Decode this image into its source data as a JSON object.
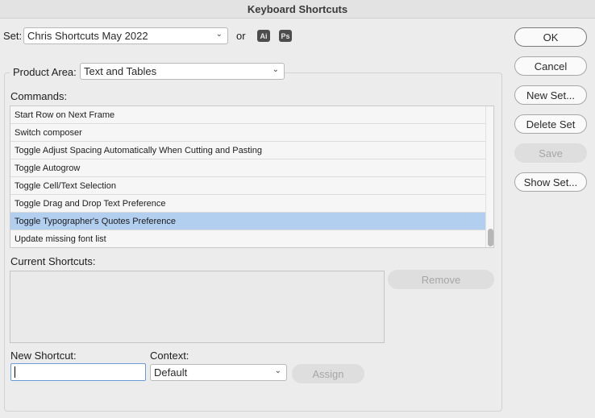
{
  "window": {
    "title": "Keyboard Shortcuts"
  },
  "set": {
    "label": "Set:",
    "value": "Chris Shortcuts May 2022",
    "or_label": "or",
    "app_icons": [
      "Ai",
      "Ps"
    ]
  },
  "product_area": {
    "label": "Product Area:",
    "value": "Text and Tables"
  },
  "commands": {
    "label": "Commands:",
    "items": [
      "Start Row on Next Frame",
      "Switch composer",
      "Toggle Adjust Spacing Automatically When Cutting and Pasting",
      "Toggle Autogrow",
      "Toggle Cell/Text Selection",
      "Toggle Drag and Drop Text Preference",
      "Toggle Typographer's Quotes Preference",
      "Update missing font list"
    ],
    "selected_index": 6
  },
  "current_shortcuts": {
    "label": "Current Shortcuts:",
    "remove_label": "Remove"
  },
  "new_shortcut": {
    "label": "New Shortcut:",
    "value": ""
  },
  "context": {
    "label": "Context:",
    "value": "Default",
    "assign_label": "Assign"
  },
  "side_buttons": {
    "ok": "OK",
    "cancel": "Cancel",
    "new_set": "New Set...",
    "delete_set": "Delete Set",
    "save": "Save",
    "show_set": "Show Set..."
  },
  "colors": {
    "selection": "#b2cff0",
    "focus_ring": "#6b9bd6"
  }
}
